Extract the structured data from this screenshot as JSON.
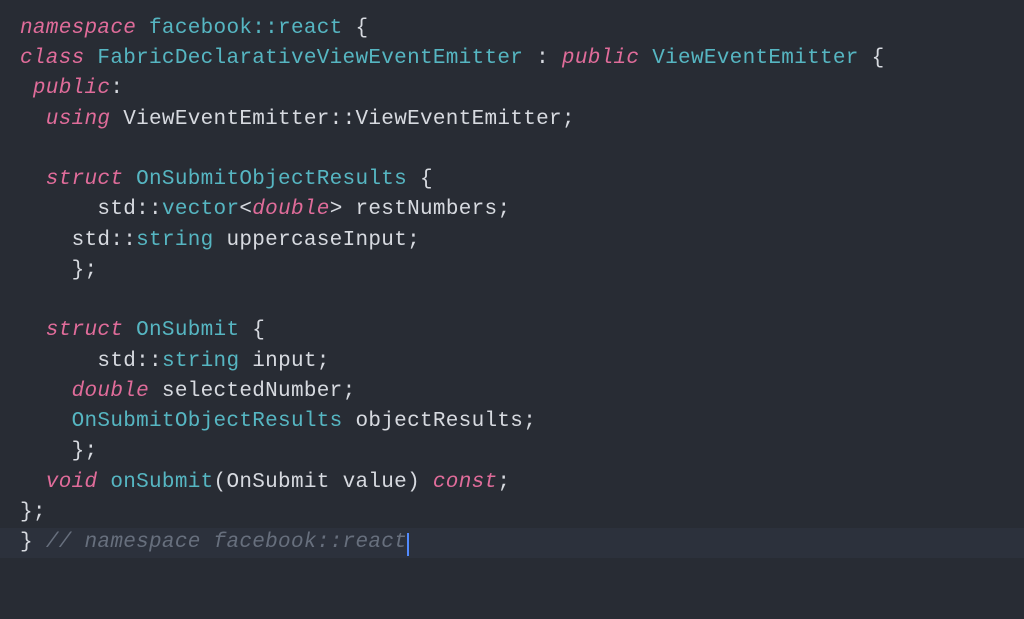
{
  "lines": {
    "l1_namespace_kw": "namespace",
    "l1_namespace_name": "facebook::react",
    "l1_brace": " {",
    "l2_class_kw": "class",
    "l2_class_name": "FabricDeclarativeViewEventEmitter",
    "l2_colon": " : ",
    "l2_public_kw": "public",
    "l2_base": "ViewEventEmitter",
    "l2_brace": " {",
    "l3_public": " public",
    "l3_colon": ":",
    "l4_using": "  using",
    "l4_scope": " ViewEventEmitter",
    "l4_dcolon": "::",
    "l4_ctor": "ViewEventEmitter",
    "l4_semi": ";",
    "l6_struct": "  struct",
    "l6_name": "OnSubmitObjectResults",
    "l6_brace": " {",
    "l7_std": "      std",
    "l7_dcolon": "::",
    "l7_vector": "vector",
    "l7_lt": "<",
    "l7_double": "double",
    "l7_gt": "> ",
    "l7_member": "restNumbers",
    "l7_semi": ";",
    "l8_std": "    std",
    "l8_dcolon": "::",
    "l8_string": "string",
    "l8_member": " uppercaseInput",
    "l8_semi": ";",
    "l9_close": "    };",
    "l11_struct": "  struct",
    "l11_name": "OnSubmit",
    "l11_brace": " {",
    "l12_std": "      std",
    "l12_dcolon": "::",
    "l12_string": "string",
    "l12_member": " input",
    "l12_semi": ";",
    "l13_double": "    double",
    "l13_member": " selectedNumber",
    "l13_semi": ";",
    "l14_type": "    OnSubmitObjectResults",
    "l14_member": " objectResults",
    "l14_semi": ";",
    "l15_close": "    };",
    "l16_void": "  void",
    "l16_fn": "onSubmit",
    "l16_lparen": "(",
    "l16_ptype": "OnSubmit",
    "l16_param": " value",
    "l16_rparen": ") ",
    "l16_const": "const",
    "l16_semi": ";",
    "l17_close": "};",
    "l18_close": "} ",
    "l18_comment": "// namespace facebook::react"
  }
}
